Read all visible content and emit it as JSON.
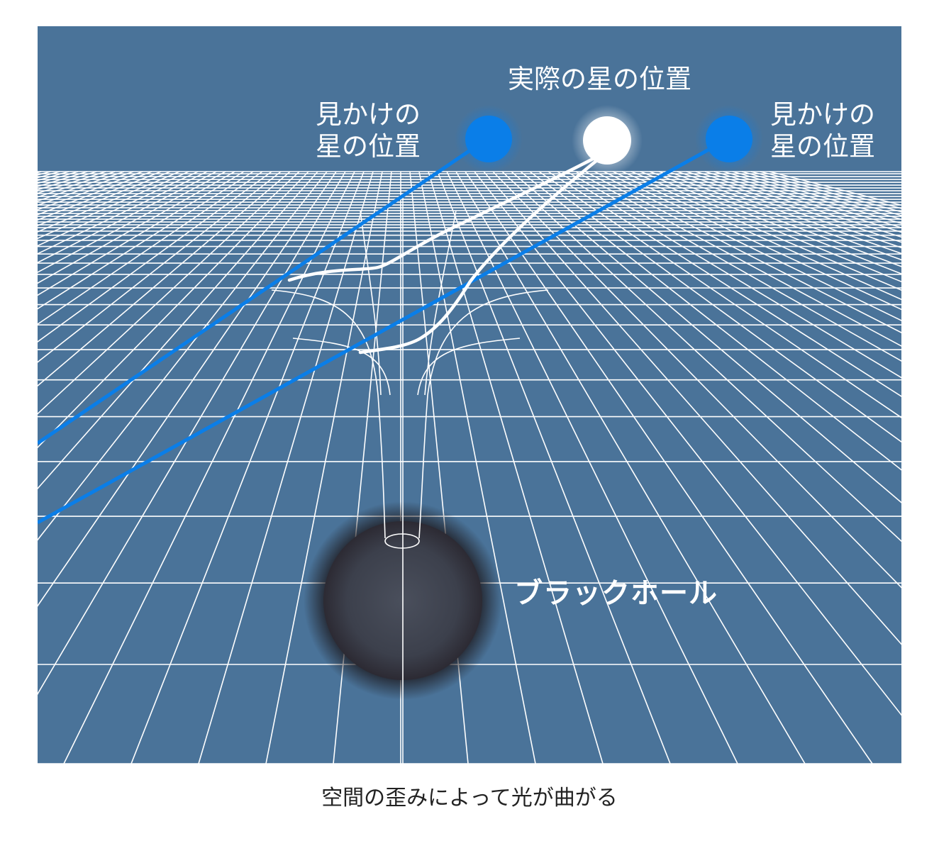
{
  "labels": {
    "actual_position": "実際の星の位置",
    "apparent_left_line1": "見かけの",
    "apparent_left_line2": "星の位置",
    "apparent_right_line1": "見かけの",
    "apparent_right_line2": "星の位置",
    "black_hole": "ブラックホール"
  },
  "caption": "空間の歪みによって光が曲がる",
  "colors": {
    "background": "#4a7399",
    "grid": "#ffffff",
    "apparent_star": "#0a7ee8",
    "actual_star": "#ffffff",
    "black_hole": "#3c3f4a",
    "page": "#ffffff"
  }
}
